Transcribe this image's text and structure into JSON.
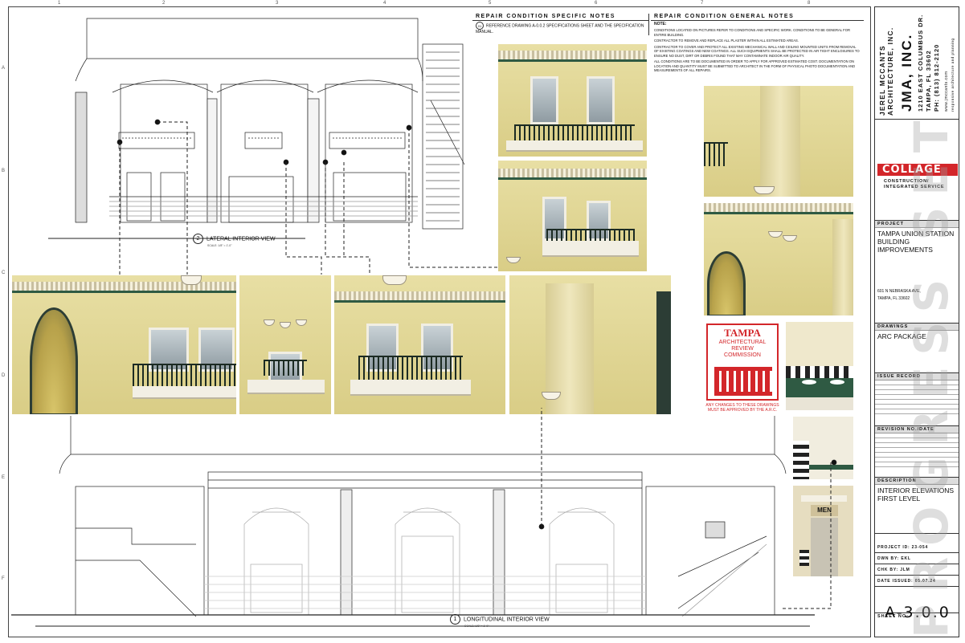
{
  "grid": {
    "columns": [
      "1",
      "2",
      "3",
      "4",
      "5",
      "6",
      "7",
      "8"
    ],
    "rows": [
      "A",
      "B",
      "C",
      "D",
      "E",
      "F"
    ]
  },
  "notes": {
    "specific_title": "REPAIR CONDITION SPECIFIC NOTES",
    "specific_tag": "01",
    "specific_text": "REFERENCE DRAWING A-0.0.2 SPECIFICATIONS SHEET AND THE SPECIFICATION MANUAL.",
    "general_title": "REPAIR CONDITION GENERAL NOTES",
    "general_label": "NOTE:",
    "general_items": [
      "CONDITIONS LOCATED ON PICTURES REFER TO CONDITIONS AND SPECIFIC WORK. CONDITIONS TO BE GENERAL FOR ENTIRE BUILDING.",
      "CONTRACTOR TO REMOVE AND REPLACE ALL PLASTER WITHIN ALL ESTIMATED AREAS.",
      "CONTRACTOR TO COVER AND PROTECT ALL EXISTING MECHANICAL WALL AND CEILING MOUNTED UNITS FROM REMOVAL OF EXISTING COATINGS AND NEW COATINGS. ALL SUCH EQUIPMENTS SHALL BE PROTECTED IN AIR TIGHT ENCLOSURES TO ENSURE NO DUST, DIRT OR DEBRIS FOUND THAT MAY CONTAMINATE INDOOR AIR QUALITY.",
      "ALL CONDITIONS ARE TO BE DOCUMENTED IN ORDER TO APPLY FOR APPROVED ESTIMATED COST. DOCUMENTATION ON LOCATION AND QUANTITY MUST BE SUBMITTED TO ARCHITECT IN THE FORM OF PHYSICAL PHOTO DOCUMENTATION AND MEASUREMENTS OF ALL REPAIRS."
    ]
  },
  "views": {
    "lateral": {
      "number": "2",
      "title": "LATERAL INTERIOR VIEW",
      "scale": "SCALE: 1/8\" = 1'-0\""
    },
    "longitudinal": {
      "number": "1",
      "title": "LONGITUDINAL INTERIOR VIEW",
      "scale": "SCALE: 1/8\" = 1'-0\""
    }
  },
  "photo_tag": "01",
  "restroom_sign": "MEN",
  "arc_seal": {
    "title": "TAMPA",
    "line1": "ARCHITECTURAL",
    "line2": "REVIEW",
    "line3": "COMMISSION",
    "warning": "ANY CHANGES TO THESE DRAWINGS MUST BE APPROVED BY THE A.R.C."
  },
  "title_block": {
    "architect_name": "JEREL MCCANTS ARCHITECTURE, INC.",
    "firm": "JMA, INC.",
    "address1": "1210 EAST COLUMBUS DR.",
    "address2": "TAMPA, FL 33602",
    "phone": "PH: (813) 812-2120",
    "website": "www.jmccants.com",
    "tagline": "responsive architecture and planning",
    "contractor_logo": "COLLAGE",
    "contractor_sub1": "CONSTRUCTION/",
    "contractor_sub2": "INTEGRATED SERVICE",
    "project_head": "PROJECT",
    "project_name": "TAMPA UNION STATION BUILDING IMPROVEMENTS",
    "project_addr1": "601 N NEBRASKA AVE,",
    "project_addr2": "TAMPA, FL 33602",
    "drawings_head": "DRAWINGS",
    "drawings_value": "ARC PACKAGE",
    "issue_head": "ISSUE RECORD",
    "revision_head": "REVISION NO./DATE",
    "description_head": "DESCRIPTION",
    "description_value": "INTERIOR ELEVATIONS FIRST LEVEL",
    "project_id": "PROJECT ID: 23-054",
    "drawn_by": "DWN BY: EKL",
    "checked_by": "CHK BY: JLM",
    "date_issued": "DATE ISSUED: 05.07.24",
    "sheet_head": "SHEET NO:",
    "sheet_no": "A-3.0.0",
    "watermark": "PROGRESS SET"
  },
  "colors": {
    "brand_red": "#d3262a",
    "wall_yellow": "#e8dfa4",
    "trim_green": "#2f5a43",
    "line": "#222222"
  }
}
